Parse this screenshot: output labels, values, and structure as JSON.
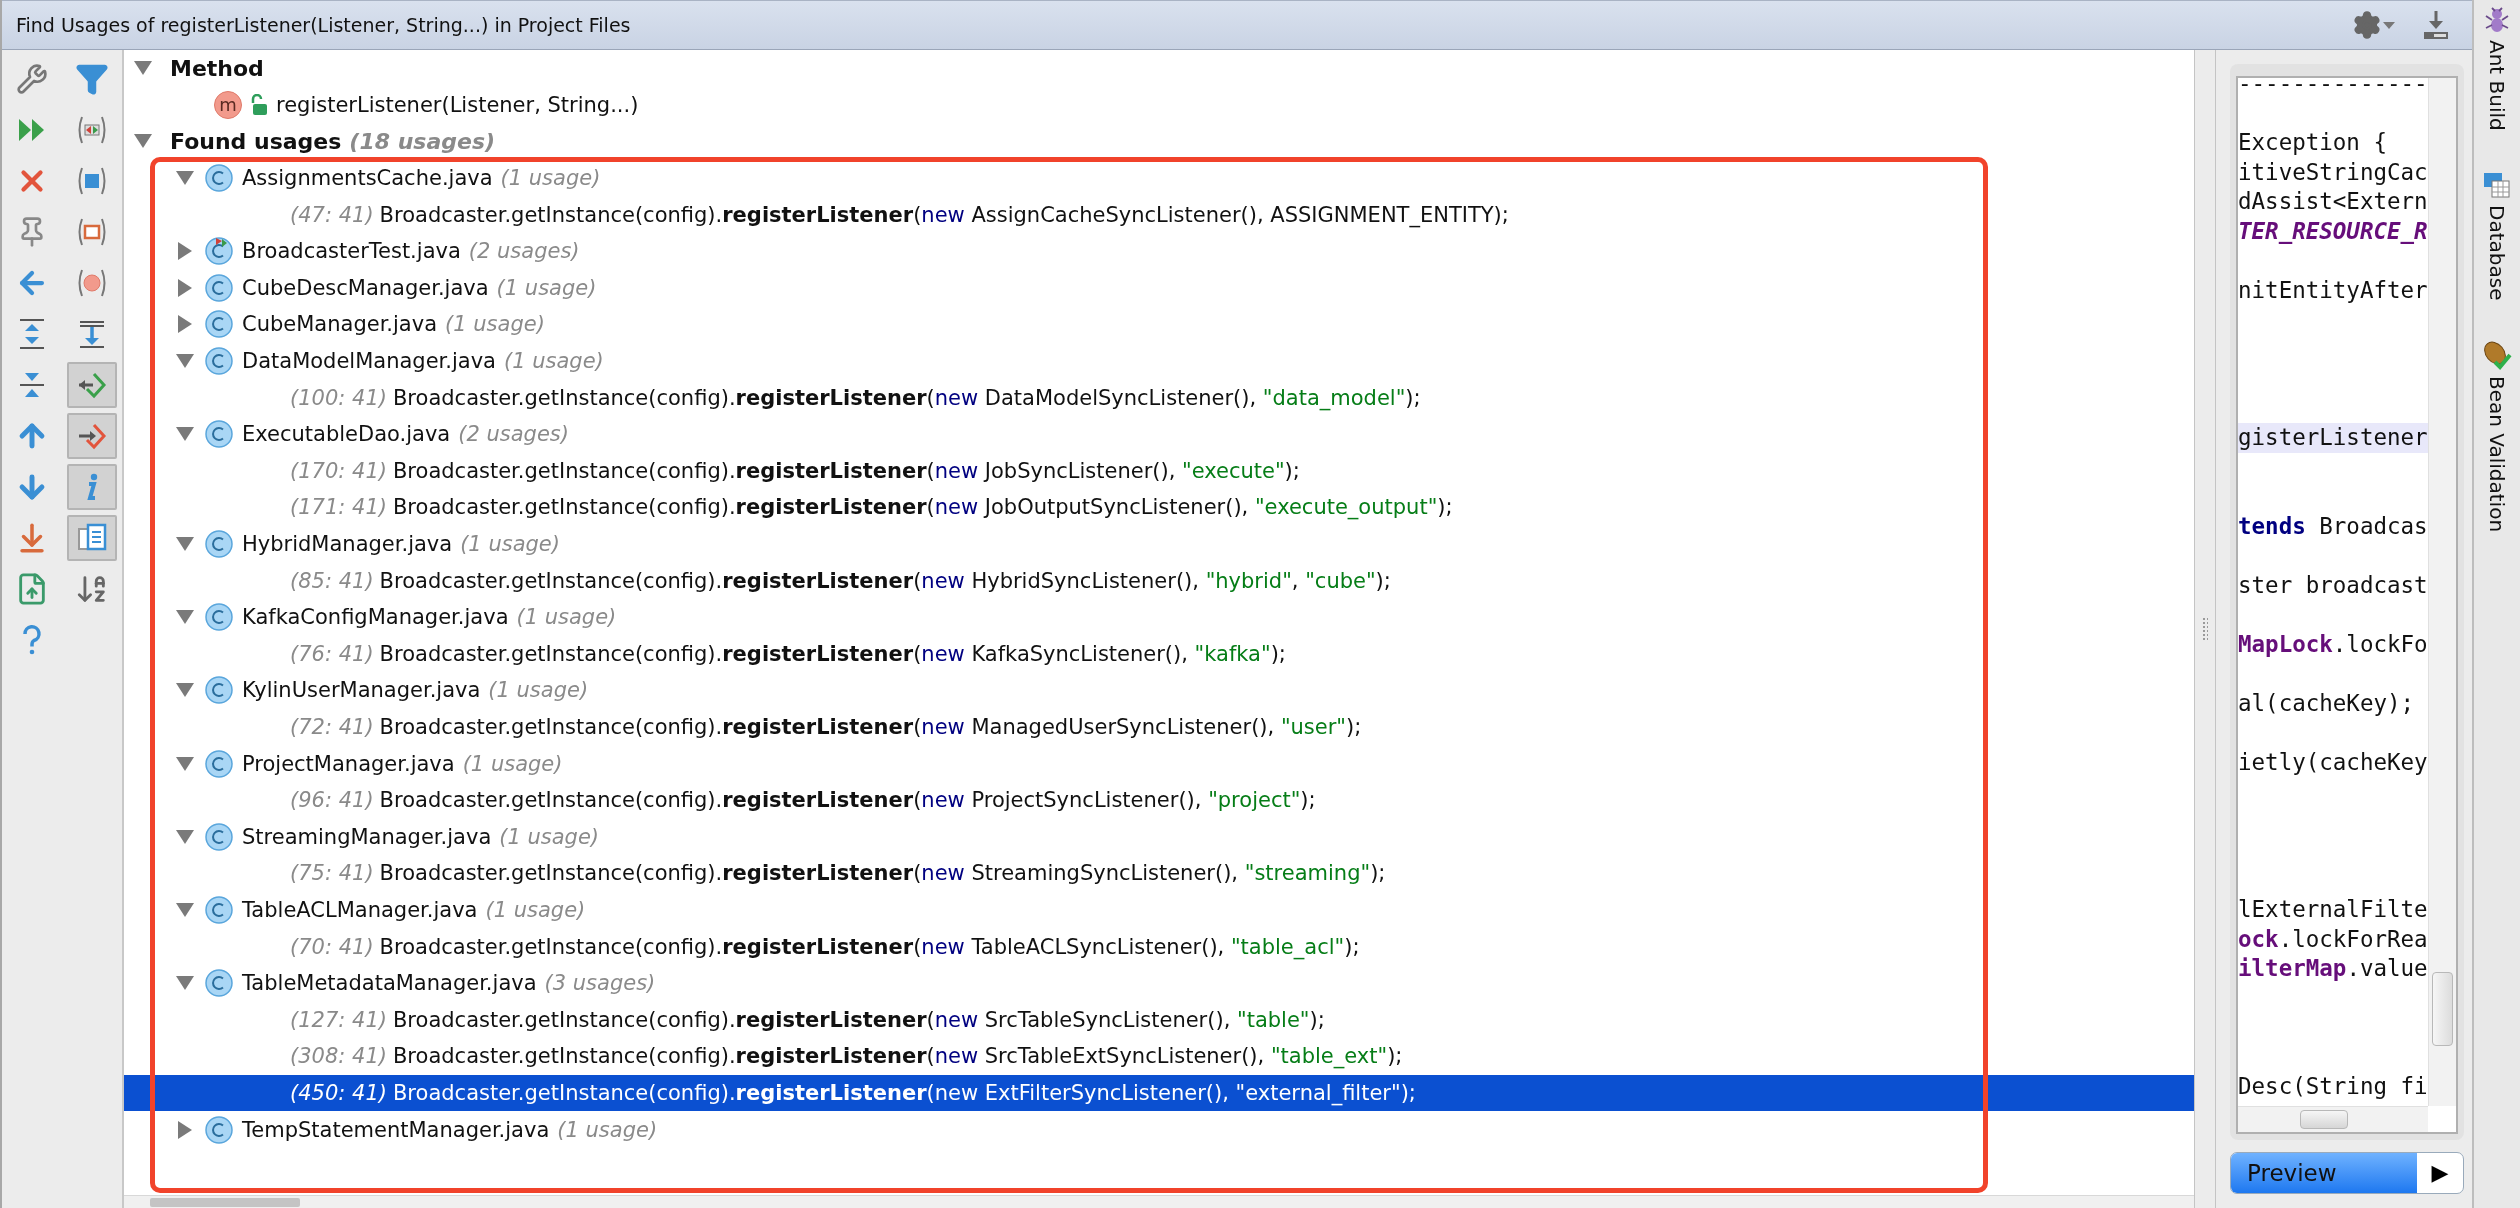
{
  "window": {
    "title": "Find Usages of registerListener(Listener, String...) in Project Files"
  },
  "toolbar_toggles": [
    {
      "on": false
    },
    {
      "on": false
    },
    {
      "on": false
    },
    {
      "on": false
    },
    {
      "on": false
    },
    {
      "on": false
    },
    {
      "on": true
    },
    {
      "on": true
    },
    {
      "on": true
    },
    {
      "on": true
    },
    {
      "on": false
    }
  ],
  "tree": [
    {
      "kind": "group",
      "label": "Method",
      "expanded": true,
      "children": [
        {
          "kind": "method",
          "badge": "m",
          "label": "registerListener(Listener, String...)"
        }
      ]
    },
    {
      "kind": "group",
      "label": "Found usages",
      "count": "(18 usages)",
      "expanded": true,
      "children": [
        {
          "kind": "file",
          "label": "AssignmentsCache.java",
          "count": "(1 usage)",
          "expanded": true,
          "children": [
            {
              "kind": "usage",
              "position": "(47: 41)",
              "selected": false,
              "tokens": [
                {
                  "text": "Broadcaster.getInstance(config).",
                  "kind": "plain"
                },
                {
                  "text": "registerListener",
                  "kind": "bold"
                },
                {
                  "text": "(",
                  "kind": "plain"
                },
                {
                  "text": "new",
                  "kind": "keyword"
                },
                {
                  "text": " AssignCacheSyncListener(), ASSIGNMENT_ENTITY);",
                  "kind": "plain"
                }
              ]
            }
          ]
        },
        {
          "kind": "test_file",
          "label": "BroadcasterTest.java",
          "count": "(2 usages)",
          "expanded": false
        },
        {
          "kind": "file",
          "label": "CubeDescManager.java",
          "count": "(1 usage)",
          "expanded": false
        },
        {
          "kind": "file",
          "label": "CubeManager.java",
          "count": "(1 usage)",
          "expanded": false
        },
        {
          "kind": "file",
          "label": "DataModelManager.java",
          "count": "(1 usage)",
          "expanded": true,
          "children": [
            {
              "kind": "usage",
              "position": "(100: 41)",
              "selected": false,
              "tokens": [
                {
                  "text": "Broadcaster.getInstance(config).",
                  "kind": "plain"
                },
                {
                  "text": "registerListener",
                  "kind": "bold"
                },
                {
                  "text": "(",
                  "kind": "plain"
                },
                {
                  "text": "new",
                  "kind": "keyword"
                },
                {
                  "text": " DataModelSyncListener(), ",
                  "kind": "plain"
                },
                {
                  "text": "\"data_model\"",
                  "kind": "string"
                },
                {
                  "text": ");",
                  "kind": "plain"
                }
              ]
            }
          ]
        },
        {
          "kind": "file",
          "label": "ExecutableDao.java",
          "count": "(2 usages)",
          "expanded": true,
          "children": [
            {
              "kind": "usage",
              "position": "(170: 41)",
              "selected": false,
              "tokens": [
                {
                  "text": "Broadcaster.getInstance(config).",
                  "kind": "plain"
                },
                {
                  "text": "registerListener",
                  "kind": "bold"
                },
                {
                  "text": "(",
                  "kind": "plain"
                },
                {
                  "text": "new",
                  "kind": "keyword"
                },
                {
                  "text": " JobSyncListener(), ",
                  "kind": "plain"
                },
                {
                  "text": "\"execute\"",
                  "kind": "string"
                },
                {
                  "text": ");",
                  "kind": "plain"
                }
              ]
            },
            {
              "kind": "usage",
              "position": "(171: 41)",
              "selected": false,
              "tokens": [
                {
                  "text": "Broadcaster.getInstance(config).",
                  "kind": "plain"
                },
                {
                  "text": "registerListener",
                  "kind": "bold"
                },
                {
                  "text": "(",
                  "kind": "plain"
                },
                {
                  "text": "new",
                  "kind": "keyword"
                },
                {
                  "text": " JobOutputSyncListener(), ",
                  "kind": "plain"
                },
                {
                  "text": "\"execute_output\"",
                  "kind": "string"
                },
                {
                  "text": ");",
                  "kind": "plain"
                }
              ]
            }
          ]
        },
        {
          "kind": "file",
          "label": "HybridManager.java",
          "count": "(1 usage)",
          "expanded": true,
          "children": [
            {
              "kind": "usage",
              "position": "(85: 41)",
              "selected": false,
              "tokens": [
                {
                  "text": "Broadcaster.getInstance(config).",
                  "kind": "plain"
                },
                {
                  "text": "registerListener",
                  "kind": "bold"
                },
                {
                  "text": "(",
                  "kind": "plain"
                },
                {
                  "text": "new",
                  "kind": "keyword"
                },
                {
                  "text": " HybridSyncListener(), ",
                  "kind": "plain"
                },
                {
                  "text": "\"hybrid\"",
                  "kind": "string"
                },
                {
                  "text": ", ",
                  "kind": "plain"
                },
                {
                  "text": "\"cube\"",
                  "kind": "string"
                },
                {
                  "text": ");",
                  "kind": "plain"
                }
              ]
            }
          ]
        },
        {
          "kind": "file",
          "label": "KafkaConfigManager.java",
          "count": "(1 usage)",
          "expanded": true,
          "children": [
            {
              "kind": "usage",
              "position": "(76: 41)",
              "selected": false,
              "tokens": [
                {
                  "text": "Broadcaster.getInstance(config).",
                  "kind": "plain"
                },
                {
                  "text": "registerListener",
                  "kind": "bold"
                },
                {
                  "text": "(",
                  "kind": "plain"
                },
                {
                  "text": "new",
                  "kind": "keyword"
                },
                {
                  "text": " KafkaSyncListener(), ",
                  "kind": "plain"
                },
                {
                  "text": "\"kafka\"",
                  "kind": "string"
                },
                {
                  "text": ");",
                  "kind": "plain"
                }
              ]
            }
          ]
        },
        {
          "kind": "file",
          "label": "KylinUserManager.java",
          "count": "(1 usage)",
          "expanded": true,
          "children": [
            {
              "kind": "usage",
              "position": "(72: 41)",
              "selected": false,
              "tokens": [
                {
                  "text": "Broadcaster.getInstance(config).",
                  "kind": "plain"
                },
                {
                  "text": "registerListener",
                  "kind": "bold"
                },
                {
                  "text": "(",
                  "kind": "plain"
                },
                {
                  "text": "new",
                  "kind": "keyword"
                },
                {
                  "text": " ManagedUserSyncListener(), ",
                  "kind": "plain"
                },
                {
                  "text": "\"user\"",
                  "kind": "string"
                },
                {
                  "text": ");",
                  "kind": "plain"
                }
              ]
            }
          ]
        },
        {
          "kind": "file",
          "label": "ProjectManager.java",
          "count": "(1 usage)",
          "expanded": true,
          "children": [
            {
              "kind": "usage",
              "position": "(96: 41)",
              "selected": false,
              "tokens": [
                {
                  "text": "Broadcaster.getInstance(config).",
                  "kind": "plain"
                },
                {
                  "text": "registerListener",
                  "kind": "bold"
                },
                {
                  "text": "(",
                  "kind": "plain"
                },
                {
                  "text": "new",
                  "kind": "keyword"
                },
                {
                  "text": " ProjectSyncListener(), ",
                  "kind": "plain"
                },
                {
                  "text": "\"project\"",
                  "kind": "string"
                },
                {
                  "text": ");",
                  "kind": "plain"
                }
              ]
            }
          ]
        },
        {
          "kind": "file",
          "label": "StreamingManager.java",
          "count": "(1 usage)",
          "expanded": true,
          "children": [
            {
              "kind": "usage",
              "position": "(75: 41)",
              "selected": false,
              "tokens": [
                {
                  "text": "Broadcaster.getInstance(config).",
                  "kind": "plain"
                },
                {
                  "text": "registerListener",
                  "kind": "bold"
                },
                {
                  "text": "(",
                  "kind": "plain"
                },
                {
                  "text": "new",
                  "kind": "keyword"
                },
                {
                  "text": " StreamingSyncListener(), ",
                  "kind": "plain"
                },
                {
                  "text": "\"streaming\"",
                  "kind": "string"
                },
                {
                  "text": ");",
                  "kind": "plain"
                }
              ]
            }
          ]
        },
        {
          "kind": "file",
          "label": "TableACLManager.java",
          "count": "(1 usage)",
          "expanded": true,
          "children": [
            {
              "kind": "usage",
              "position": "(70: 41)",
              "selected": false,
              "tokens": [
                {
                  "text": "Broadcaster.getInstance(config).",
                  "kind": "plain"
                },
                {
                  "text": "registerListener",
                  "kind": "bold"
                },
                {
                  "text": "(",
                  "kind": "plain"
                },
                {
                  "text": "new",
                  "kind": "keyword"
                },
                {
                  "text": " TableACLSyncListener(), ",
                  "kind": "plain"
                },
                {
                  "text": "\"table_acl\"",
                  "kind": "string"
                },
                {
                  "text": ");",
                  "kind": "plain"
                }
              ]
            }
          ]
        },
        {
          "kind": "file",
          "label": "TableMetadataManager.java",
          "count": "(3 usages)",
          "expanded": true,
          "children": [
            {
              "kind": "usage",
              "position": "(127: 41)",
              "selected": false,
              "tokens": [
                {
                  "text": "Broadcaster.getInstance(config).",
                  "kind": "plain"
                },
                {
                  "text": "registerListener",
                  "kind": "bold"
                },
                {
                  "text": "(",
                  "kind": "plain"
                },
                {
                  "text": "new",
                  "kind": "keyword"
                },
                {
                  "text": " SrcTableSyncListener(), ",
                  "kind": "plain"
                },
                {
                  "text": "\"table\"",
                  "kind": "string"
                },
                {
                  "text": ");",
                  "kind": "plain"
                }
              ]
            },
            {
              "kind": "usage",
              "position": "(308: 41)",
              "selected": false,
              "tokens": [
                {
                  "text": "Broadcaster.getInstance(config).",
                  "kind": "plain"
                },
                {
                  "text": "registerListener",
                  "kind": "bold"
                },
                {
                  "text": "(",
                  "kind": "plain"
                },
                {
                  "text": "new",
                  "kind": "keyword"
                },
                {
                  "text": " SrcTableExtSyncListener(), ",
                  "kind": "plain"
                },
                {
                  "text": "\"table_ext\"",
                  "kind": "string"
                },
                {
                  "text": ");",
                  "kind": "plain"
                }
              ]
            },
            {
              "kind": "usage",
              "position": "(450: 41)",
              "selected": true,
              "tokens": [
                {
                  "text": "Broadcaster.getInstance(config).",
                  "kind": "plain"
                },
                {
                  "text": "registerListener",
                  "kind": "bold"
                },
                {
                  "text": "(",
                  "kind": "plain"
                },
                {
                  "text": "new",
                  "kind": "keyword"
                },
                {
                  "text": " ExtFilterSyncListener(), ",
                  "kind": "plain"
                },
                {
                  "text": "\"external_filter\"",
                  "kind": "string"
                },
                {
                  "text": ");",
                  "kind": "plain"
                }
              ]
            }
          ]
        },
        {
          "kind": "file",
          "label": "TempStatementManager.java",
          "count": "(1 usage)",
          "expanded": false
        }
      ]
    }
  ],
  "preview": {
    "lines": [
      {
        "kind": "code",
        "highlighted": false,
        "tokens": [
          {
            "text": "--------------",
            "kind": "plain"
          }
        ]
      },
      {
        "kind": "blank"
      },
      {
        "kind": "code",
        "highlighted": false,
        "tokens": [
          {
            "text": "Exception {",
            "kind": "plain"
          }
        ]
      },
      {
        "kind": "code",
        "highlighted": false,
        "tokens": [
          {
            "text": "itiveStringCac",
            "kind": "plain"
          }
        ]
      },
      {
        "kind": "code",
        "highlighted": false,
        "tokens": [
          {
            "text": "dAssist<Extern",
            "kind": "plain"
          }
        ]
      },
      {
        "kind": "code",
        "highlighted": false,
        "tokens": [
          {
            "text": "TER_RESOURCE_R",
            "kind": "constant"
          }
        ]
      },
      {
        "kind": "blank"
      },
      {
        "kind": "code",
        "highlighted": false,
        "tokens": [
          {
            "text": "nitEntityAfter",
            "kind": "plain"
          }
        ]
      },
      {
        "kind": "blank"
      },
      {
        "kind": "blank"
      },
      {
        "kind": "blank"
      },
      {
        "kind": "blank"
      },
      {
        "kind": "code",
        "highlighted": true,
        "tokens": [
          {
            "text": "gisterListener",
            "kind": "plain"
          }
        ]
      },
      {
        "kind": "blank"
      },
      {
        "kind": "blank"
      },
      {
        "kind": "code",
        "highlighted": false,
        "tokens": [
          {
            "text": "tends",
            "kind": "keyword"
          },
          {
            "text": " Broadcas",
            "kind": "plain"
          }
        ]
      },
      {
        "kind": "blank"
      },
      {
        "kind": "code",
        "highlighted": false,
        "tokens": [
          {
            "text": "ster broadcast",
            "kind": "plain"
          }
        ]
      },
      {
        "kind": "blank"
      },
      {
        "kind": "code",
        "highlighted": false,
        "tokens": [
          {
            "text": "MapLock",
            "kind": "field"
          },
          {
            "text": ".lockFo",
            "kind": "plain"
          }
        ]
      },
      {
        "kind": "blank"
      },
      {
        "kind": "code",
        "highlighted": false,
        "tokens": [
          {
            "text": "al(cacheKey);",
            "kind": "plain"
          }
        ]
      },
      {
        "kind": "blank"
      },
      {
        "kind": "code",
        "highlighted": false,
        "tokens": [
          {
            "text": "ietly(cacheKey",
            "kind": "plain"
          }
        ]
      },
      {
        "kind": "blank"
      },
      {
        "kind": "blank"
      },
      {
        "kind": "blank"
      },
      {
        "kind": "blank"
      },
      {
        "kind": "code",
        "highlighted": false,
        "tokens": [
          {
            "text": "lExternalFilte",
            "kind": "plain"
          }
        ]
      },
      {
        "kind": "code",
        "highlighted": false,
        "tokens": [
          {
            "text": "ock",
            "kind": "field"
          },
          {
            "text": ".lockForRea",
            "kind": "plain"
          }
        ]
      },
      {
        "kind": "code",
        "highlighted": false,
        "tokens": [
          {
            "text": "ilterMap",
            "kind": "field"
          },
          {
            "text": ".value",
            "kind": "plain"
          }
        ]
      },
      {
        "kind": "blank"
      },
      {
        "kind": "blank"
      },
      {
        "kind": "blank"
      },
      {
        "kind": "code",
        "highlighted": false,
        "tokens": [
          {
            "text": "Desc(String fi",
            "kind": "plain"
          }
        ]
      }
    ],
    "button": {
      "label": "Preview",
      "arrow": "▶"
    }
  },
  "side_tabs": [
    {
      "label": "Ant Build"
    },
    {
      "label": "Database"
    },
    {
      "label": "Bean Validation"
    }
  ]
}
